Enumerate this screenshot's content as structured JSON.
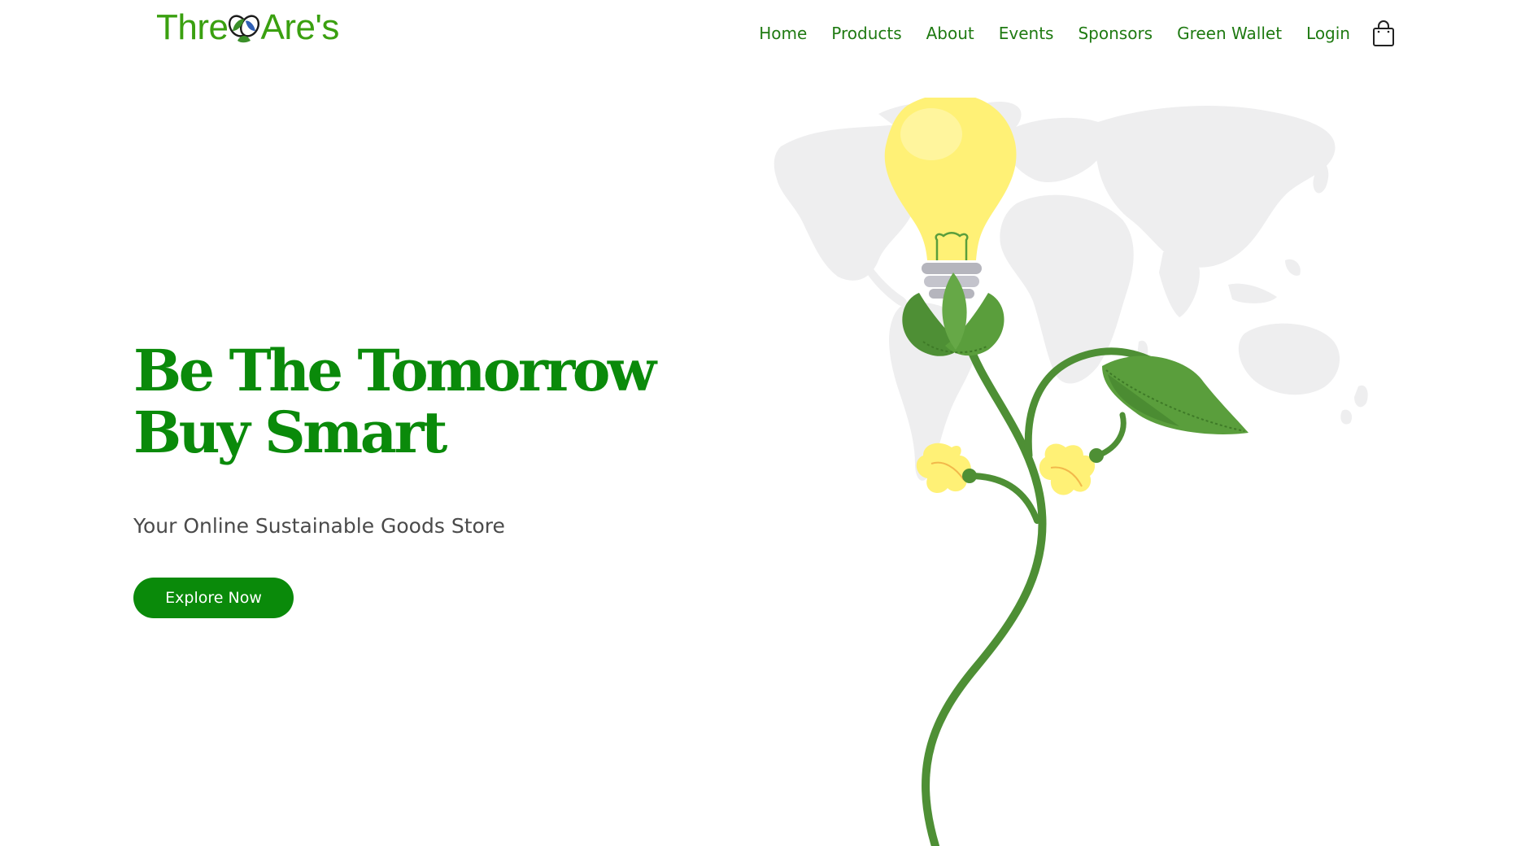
{
  "header": {
    "logo_prefix": "Thre",
    "logo_suffix": "Are's",
    "nav": [
      {
        "label": "Home"
      },
      {
        "label": "Products"
      },
      {
        "label": "About"
      },
      {
        "label": "Events"
      },
      {
        "label": "Sponsors"
      },
      {
        "label": "Green Wallet"
      },
      {
        "label": "Login"
      }
    ],
    "cart_icon": "shopping-bag-icon"
  },
  "hero": {
    "title_line1": "Be The Tomorrow",
    "title_line2": "Buy Smart",
    "subtitle": "Your Online Sustainable Goods Store",
    "cta_label": "Explore Now"
  },
  "illustration": {
    "icons": [
      "world-map",
      "lightbulb-icon",
      "plant-stem",
      "leaf-icon",
      "flower-icon"
    ]
  },
  "colors": {
    "brand_green": "#0a8a0a",
    "nav_green": "#1f7a12",
    "logo_green": "#3aa010",
    "bulb_yellow": "#fff176",
    "leaf_green": "#4e9a3a",
    "map_grey": "#eeeeef"
  }
}
